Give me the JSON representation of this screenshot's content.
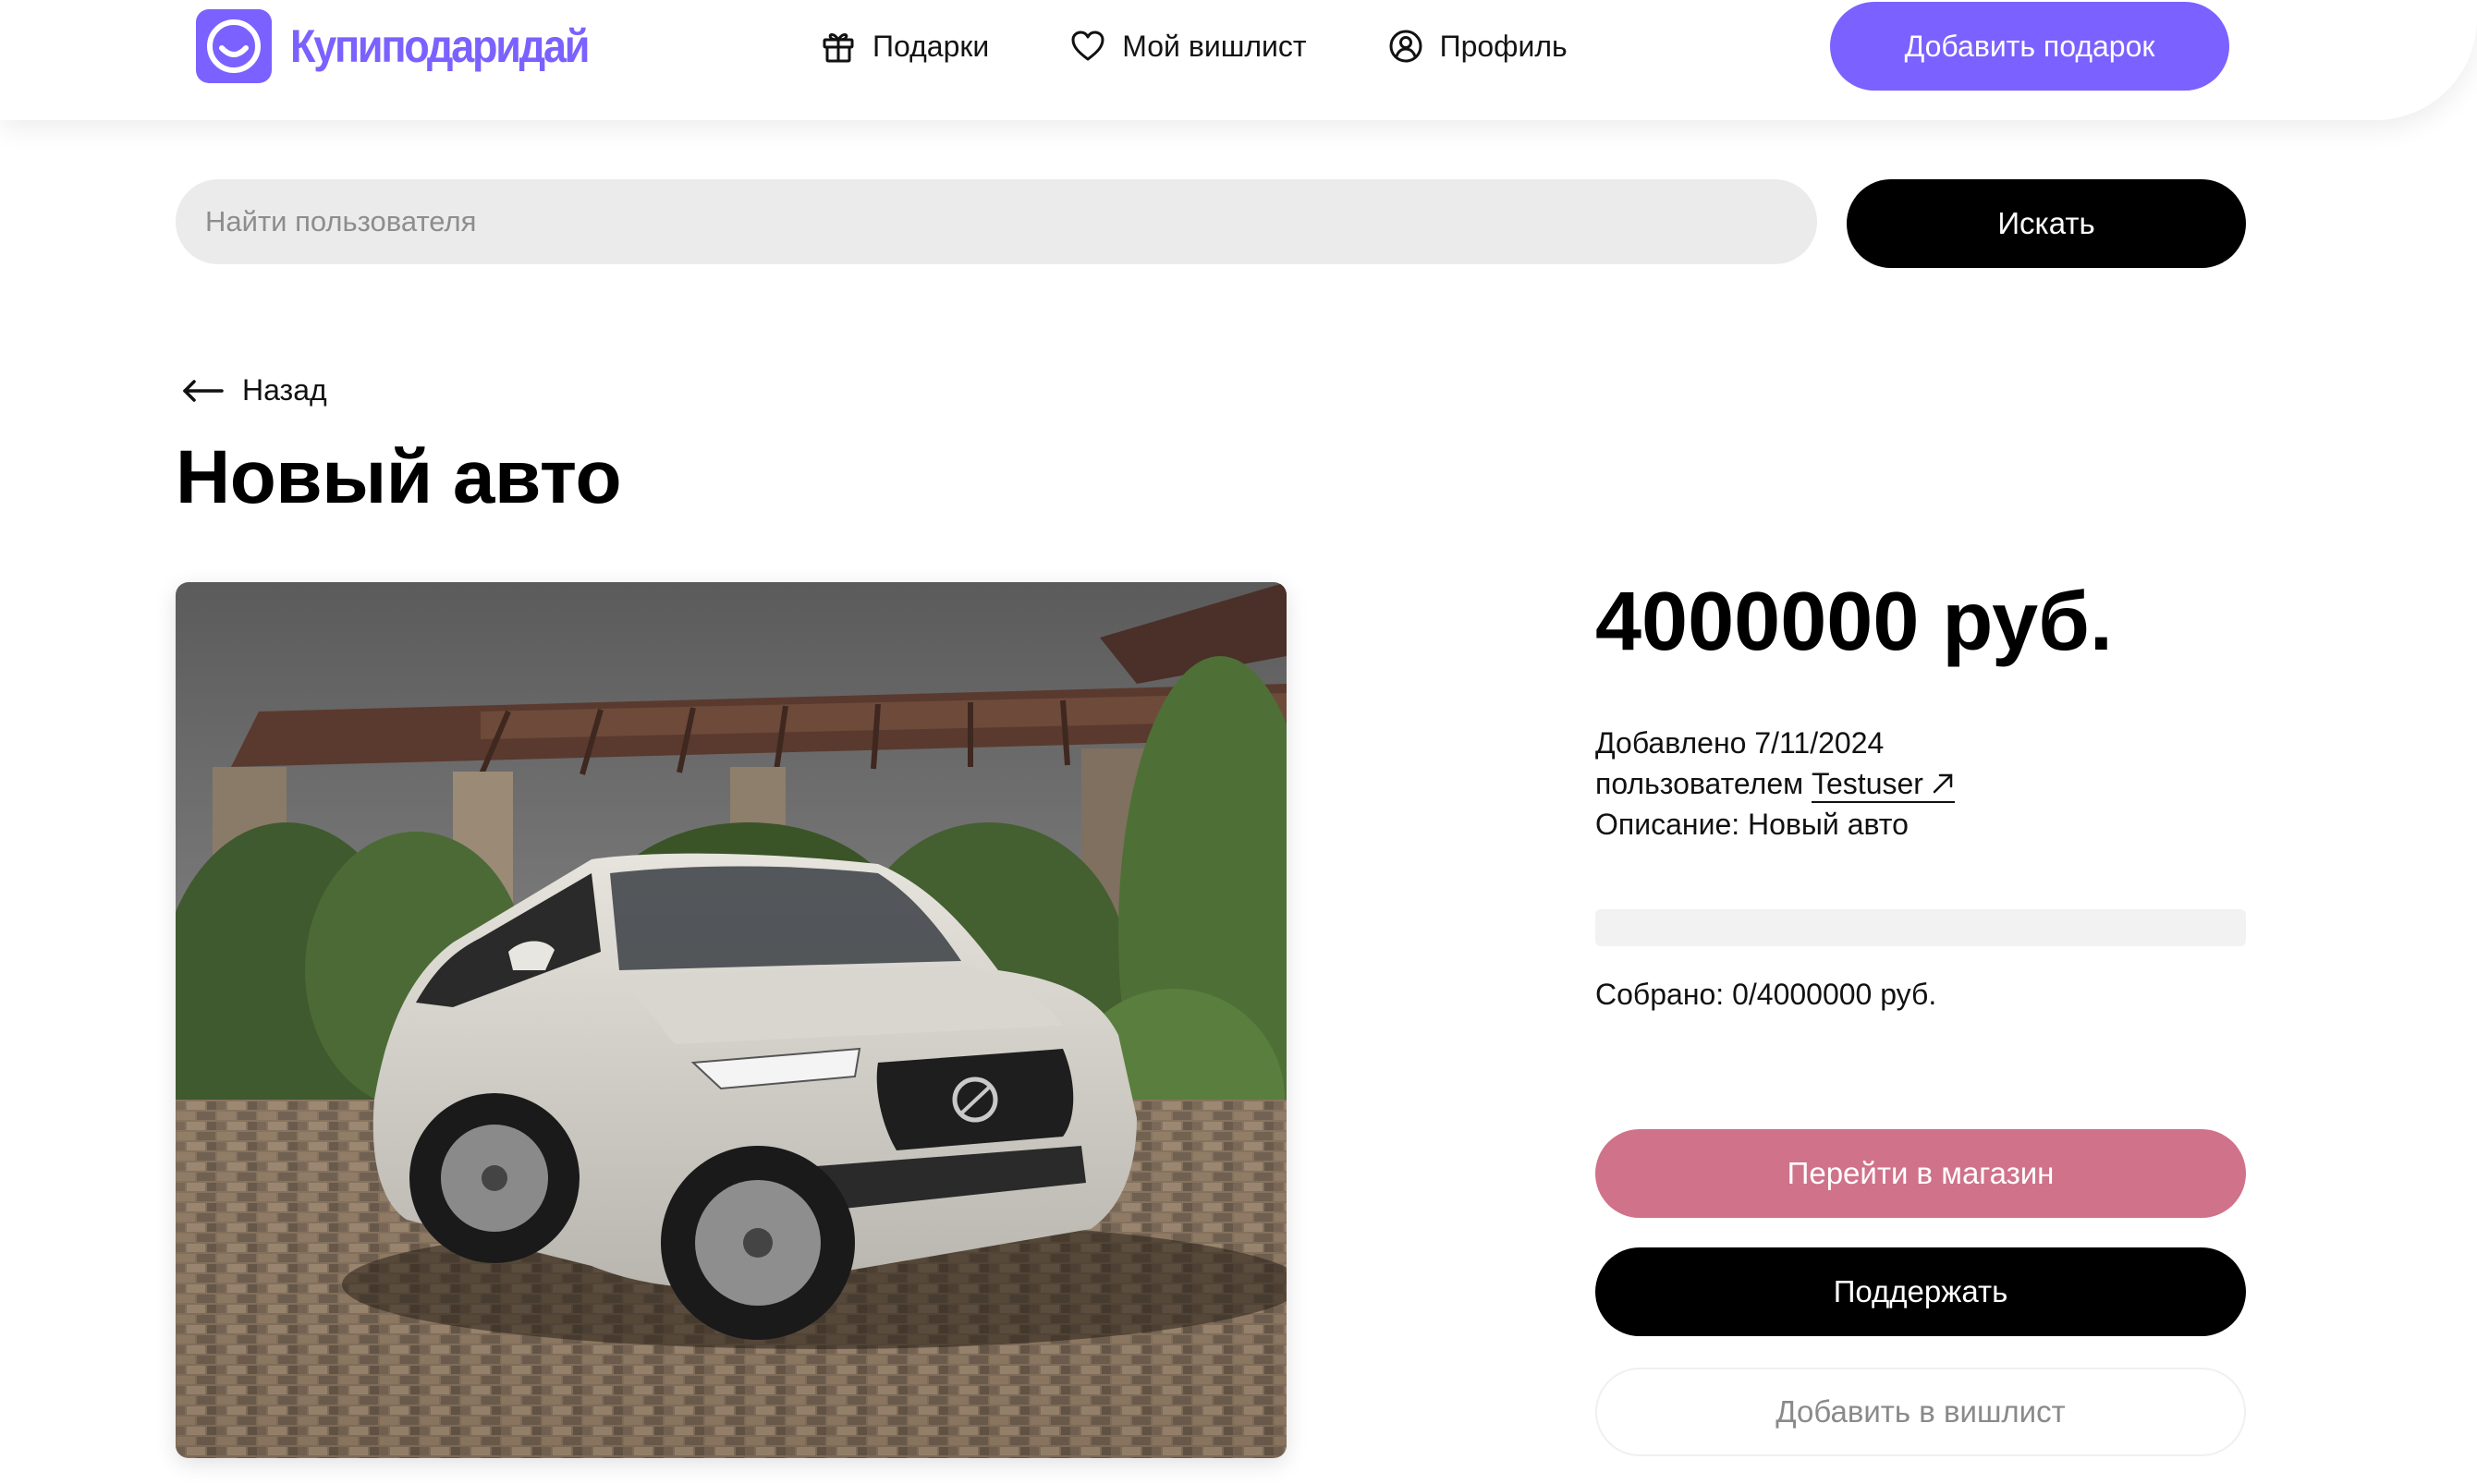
{
  "brand": {
    "name": "Купиподаридай",
    "color": "#7b61ff",
    "logo_icon": "smile-logo-icon"
  },
  "nav": {
    "items": [
      {
        "label": "Подарки",
        "icon": "gift-icon"
      },
      {
        "label": "Мой вишлист",
        "icon": "heart-icon"
      },
      {
        "label": "Профиль",
        "icon": "user-circle-icon"
      }
    ],
    "add_gift_label": "Добавить подарок"
  },
  "search": {
    "placeholder": "Найти пользователя",
    "value": "",
    "button_label": "Искать"
  },
  "back": {
    "label": "Назад",
    "icon": "arrow-left-icon"
  },
  "gift": {
    "title": "Новый авто",
    "image_alt": "Новый авто",
    "price": "4000000 руб.",
    "added_text": "Добавлено 7/11/2024",
    "by_prefix": "пользователем",
    "user": "Testuser",
    "description": "Описание: Новый авто",
    "collected_text": "Собрано: 0/4000000 руб.",
    "collected": 0,
    "goal": 4000000
  },
  "actions": {
    "shop_label": "Перейти в магазин",
    "support_label": "Поддержать",
    "wishlist_label": "Добавить в вишлист"
  },
  "colors": {
    "accent": "#7b61ff",
    "shop_button": "#d0728a",
    "primary_button": "#000000",
    "input_bg": "#ebebeb"
  }
}
